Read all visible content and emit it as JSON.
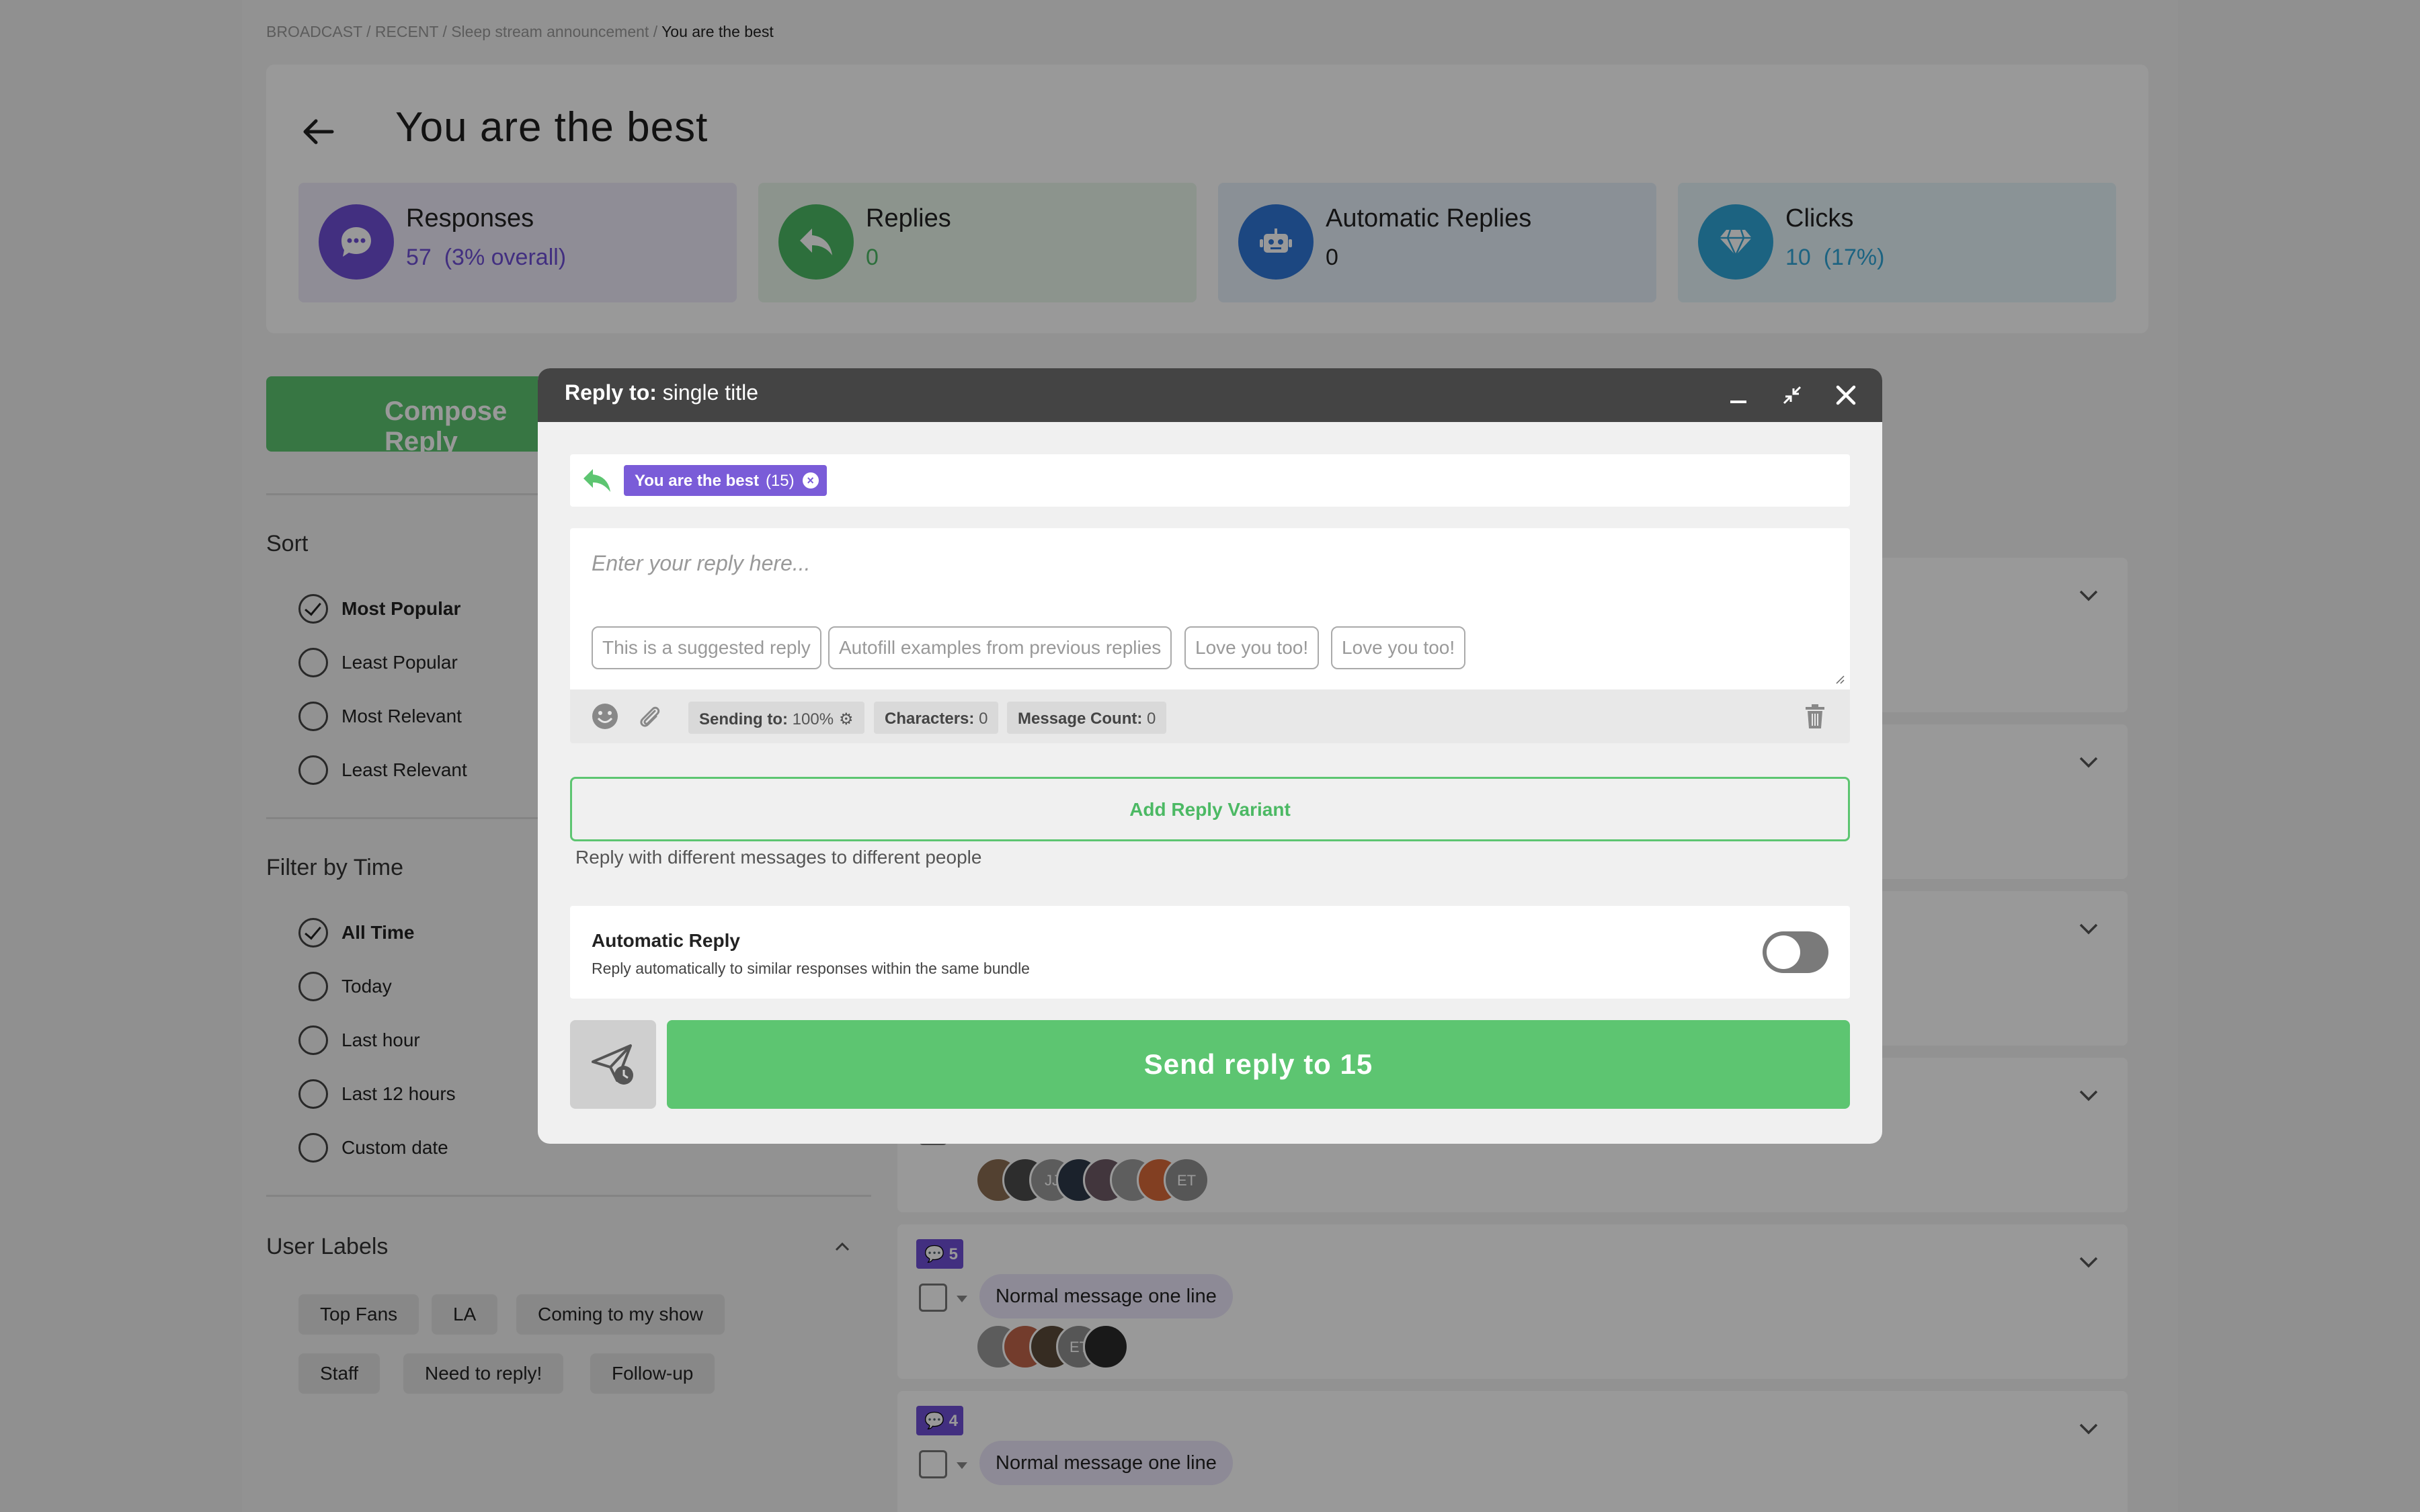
{
  "breadcrumb": {
    "items": [
      "BROADCAST",
      "RECENT",
      "Sleep stream announcement"
    ],
    "separator": "/",
    "current": "You are the best"
  },
  "header": {
    "title": "You are the best",
    "back_icon": "arrow-left-icon"
  },
  "stats": [
    {
      "label": "Responses",
      "value": "57",
      "extra": "(3% overall)",
      "icon": "chat-bubble-icon",
      "color": "#6f4fd6",
      "bg": "#efebfb"
    },
    {
      "label": "Replies",
      "value": "0",
      "extra": "",
      "icon": "reply-arrow-icon",
      "color": "#4cb964",
      "bg": "#e9f7ec"
    },
    {
      "label": "Automatic Replies",
      "value": "0",
      "extra": "",
      "icon": "robot-icon",
      "color": "#2f77d8",
      "bg": "#e7f0fb"
    },
    {
      "label": "Clicks",
      "value": "10",
      "extra": "(17%)",
      "icon": "diamond-icon",
      "color": "#2fa5d8",
      "bg": "#e6f6fb"
    }
  ],
  "compose": {
    "label": "Compose Reply"
  },
  "sort": {
    "title": "Sort",
    "options": [
      "Most Popular",
      "Least Popular",
      "Most Relevant",
      "Least Relevant"
    ],
    "selected": "Most Popular"
  },
  "time_filter": {
    "title": "Filter by Time",
    "options": [
      "All Time",
      "Today",
      "Last hour",
      "Last 12 hours",
      "Custom date"
    ],
    "selected": "All Time"
  },
  "user_labels": {
    "title": "User Labels",
    "labels": [
      "Top Fans",
      "LA",
      "Coming to my show",
      "Staff",
      "Need to reply!",
      "Follow-up"
    ]
  },
  "message_list": [
    {
      "count": "",
      "text": ""
    },
    {
      "count": "",
      "text": ""
    },
    {
      "count": "",
      "text": ""
    },
    {
      "count": "",
      "text": "",
      "avatars": [
        "",
        "",
        "JJ",
        "",
        "",
        "",
        "",
        "ET"
      ]
    },
    {
      "count": "5",
      "text": "Normal message one line",
      "avatars": [
        "",
        "",
        "",
        "ET",
        ""
      ]
    },
    {
      "count": "4",
      "text": "Normal message one line",
      "avatars": []
    }
  ],
  "modal": {
    "title_prefix": "Reply to:",
    "title_value": "single title",
    "recipient_tag": {
      "label": "You are the best",
      "count": "(15)"
    },
    "reply_placeholder": "Enter your reply here...",
    "suggestions": [
      "This is a suggested reply",
      "Autofill examples from previous replies",
      "Love you too!",
      "Love you too!"
    ],
    "toolbar": {
      "sending_label": "Sending to:",
      "sending_value": "100%",
      "chars_label": "Characters:",
      "chars_value": "0",
      "count_label": "Message Count:",
      "count_value": "0"
    },
    "add_variant": "Add Reply Variant",
    "variant_help": "Reply with different messages to different people",
    "auto_reply": {
      "title": "Automatic Reply",
      "subtitle": "Reply automatically to similar responses within the same bundle",
      "enabled": false
    },
    "send_label": "Send reply to 15"
  },
  "colors": {
    "accent_green": "#5dc571",
    "accent_purple": "#6f4fd6",
    "modal_header": "#444444"
  }
}
